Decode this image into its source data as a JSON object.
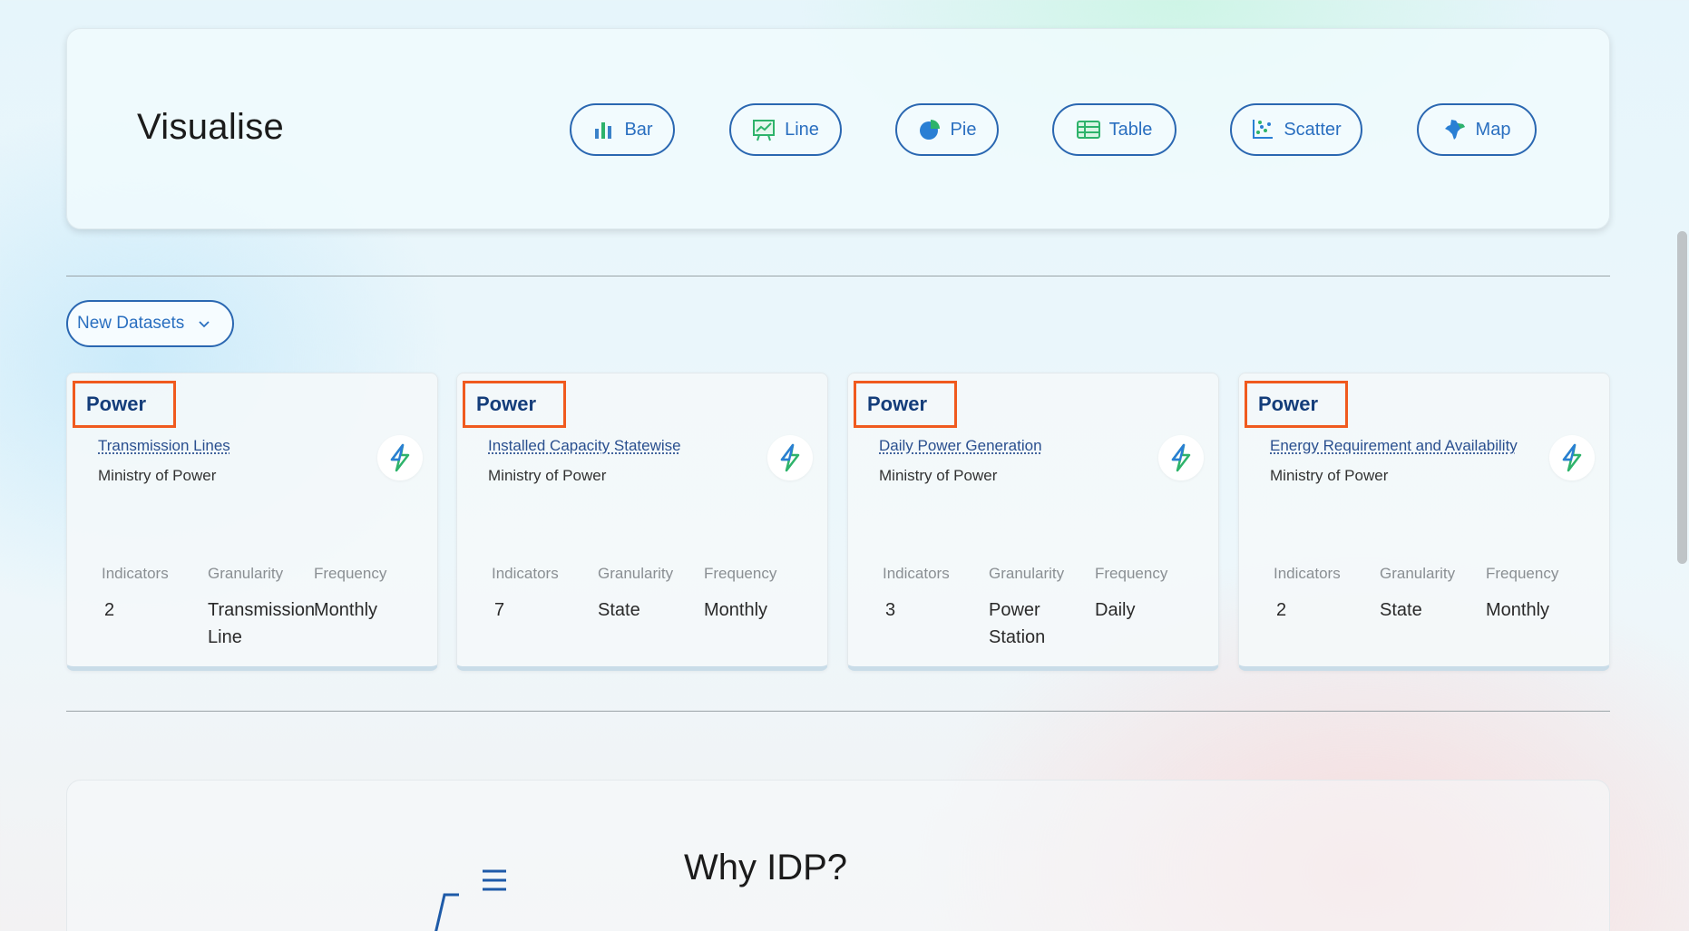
{
  "visualise": {
    "title": "Visualise",
    "buttons": [
      {
        "label": "Bar",
        "icon": "bar-chart-icon"
      },
      {
        "label": "Line",
        "icon": "line-chart-icon"
      },
      {
        "label": "Pie",
        "icon": "pie-chart-icon"
      },
      {
        "label": "Table",
        "icon": "table-icon"
      },
      {
        "label": "Scatter",
        "icon": "scatter-chart-icon"
      },
      {
        "label": "Map",
        "icon": "india-map-icon"
      }
    ]
  },
  "datasets_filter": {
    "label": "New Datasets",
    "icon": "chevron-down-icon"
  },
  "cards": [
    {
      "sector": "Power",
      "title": "Transmission Lines",
      "ministry": "Ministry of Power",
      "indicators_label": "Indicators",
      "granularity_label": "Granularity",
      "frequency_label": "Frequency",
      "indicators": "2",
      "granularity": "Transmission Line",
      "frequency": "Monthly"
    },
    {
      "sector": "Power",
      "title": "Installed Capacity Statewise",
      "ministry": "Ministry of Power",
      "indicators_label": "Indicators",
      "granularity_label": "Granularity",
      "frequency_label": "Frequency",
      "indicators": "7",
      "granularity": "State",
      "frequency": "Monthly"
    },
    {
      "sector": "Power",
      "title": "Daily Power Generation",
      "ministry": "Ministry of Power",
      "indicators_label": "Indicators",
      "granularity_label": "Granularity",
      "frequency_label": "Frequency",
      "indicators": "3",
      "granularity": "Power Station",
      "frequency": "Daily"
    },
    {
      "sector": "Power",
      "title": "Energy Requirement and Availability",
      "ministry": "Ministry of Power",
      "indicators_label": "Indicators",
      "granularity_label": "Granularity",
      "frequency_label": "Frequency",
      "indicators": "2",
      "granularity": "State",
      "frequency": "Monthly"
    }
  ],
  "why": {
    "title": "Why IDP?"
  },
  "colors": {
    "accent": "#2a67b1",
    "highlight_box": "#f05a1e",
    "sector_text": "#143d7a"
  }
}
